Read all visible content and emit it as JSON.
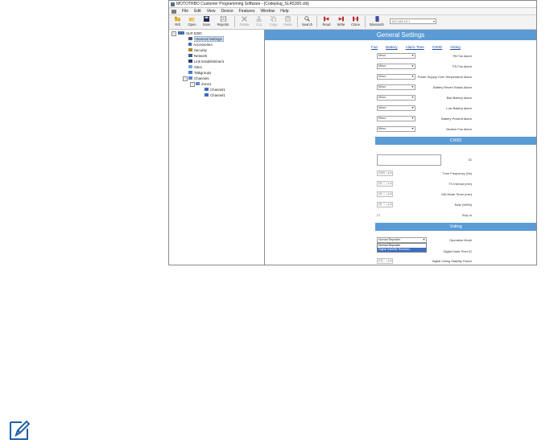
{
  "window": {
    "title": "MOTOTRBO Customer Programming Software - [Codeplug_SLR5300.ctb]"
  },
  "menu": [
    "File",
    "Edit",
    "View",
    "Device",
    "Features",
    "Window",
    "Help"
  ],
  "toolbar": {
    "buttons": [
      {
        "label": "Rdt",
        "icon": "folder-icon",
        "enabled": true
      },
      {
        "label": "Open",
        "icon": "open-folder-icon",
        "enabled": true
      },
      {
        "label": "Save",
        "icon": "save-icon",
        "enabled": true
      },
      {
        "label": "Reports",
        "icon": "report-icon",
        "enabled": true
      },
      {
        "label": "Delete",
        "icon": "delete-icon",
        "enabled": false
      },
      {
        "label": "Cut",
        "icon": "cut-icon",
        "enabled": false
      },
      {
        "label": "Copy",
        "icon": "copy-icon",
        "enabled": false
      },
      {
        "label": "Paste",
        "icon": "paste-icon",
        "enabled": false
      },
      {
        "label": "Search",
        "icon": "search-icon",
        "enabled": true
      },
      {
        "label": "Read",
        "icon": "read-icon",
        "enabled": true
      },
      {
        "label": "Write",
        "icon": "write-icon",
        "enabled": true
      },
      {
        "label": "Clone",
        "icon": "clone-icon",
        "enabled": true
      },
      {
        "label": "Bluetooth",
        "icon": "bluetooth-icon",
        "enabled": true
      }
    ],
    "device_combo": "192.168.10.1"
  },
  "tree": {
    "root": "SLR 5300",
    "items": [
      {
        "label": "General Settings",
        "icon": "settings-icon",
        "selected": true
      },
      {
        "label": "Accessories",
        "icon": "accessory-icon",
        "selected": false
      },
      {
        "label": "Security",
        "icon": "key-icon",
        "selected": false
      },
      {
        "label": "Network",
        "icon": "network-icon",
        "selected": false
      },
      {
        "label": "Link Establishment",
        "icon": "link-icon",
        "selected": false
      },
      {
        "label": "Sites",
        "icon": "sites-icon",
        "selected": false
      },
      {
        "label": "Talkgroups",
        "icon": "talkgroup-icon",
        "selected": false
      },
      {
        "label": "Channels",
        "icon": "channels-icon",
        "selected": false
      },
      {
        "label": "Zone1",
        "icon": "zone-icon",
        "selected": false
      },
      {
        "label": "Channel1",
        "icon": "channel-icon",
        "selected": false
      },
      {
        "label": "Channel1",
        "icon": "channel-icon",
        "selected": false
      }
    ]
  },
  "general": {
    "title": "General Settings",
    "links": [
      "Fan",
      "Battery",
      "Alarm Tone",
      "CWID",
      "Voting"
    ],
    "alarms": [
      {
        "label": "PA Fan Alarm",
        "value": "Minor"
      },
      {
        "label": "PS Fan Alarm",
        "value": "Minor"
      },
      {
        "label": "Power Supply Over Temperature Alarm",
        "value": "Minor"
      },
      {
        "label": "Battery Revert Status Alarm",
        "value": "Minor"
      },
      {
        "label": "Bad Battery Alarm",
        "value": "Minor"
      },
      {
        "label": "Low Battery Alarm",
        "value": "Minor"
      },
      {
        "label": "Battery Present Alarm",
        "value": "Minor"
      },
      {
        "label": "Modem Fan Alarm",
        "value": "Minor"
      }
    ]
  },
  "cwid": {
    "title": "CWID",
    "id_label": "ID",
    "fields": [
      {
        "label": "Tone Frequency (Hz)",
        "value": "1000"
      },
      {
        "label": "TX Interval (min)",
        "value": "15"
      },
      {
        "label": "Mix Mode Timer (min)",
        "value": "15"
      },
      {
        "label": "Rate (WPM)",
        "value": "20"
      }
    ],
    "ship_label": "Ship In",
    "ship_value": "27"
  },
  "voting": {
    "title": "Voting",
    "operation_mode_label": "Operation Mode",
    "operation_mode_value": "Normal Repeater",
    "options": [
      "Normal Repeater",
      "Digital Satellite Receiver"
    ],
    "highlighted_option": "Digital Satellite Receiver",
    "row2_label": "Digital Voter Peer ID",
    "row3_label": "Digital Voting Stability Factor",
    "row3_value": "0.5"
  },
  "colors": {
    "banner": "#5b9bd5",
    "link": "#1f4fa8",
    "highlight": "#3c6fc4"
  },
  "note_icon": "pencil-note-icon"
}
